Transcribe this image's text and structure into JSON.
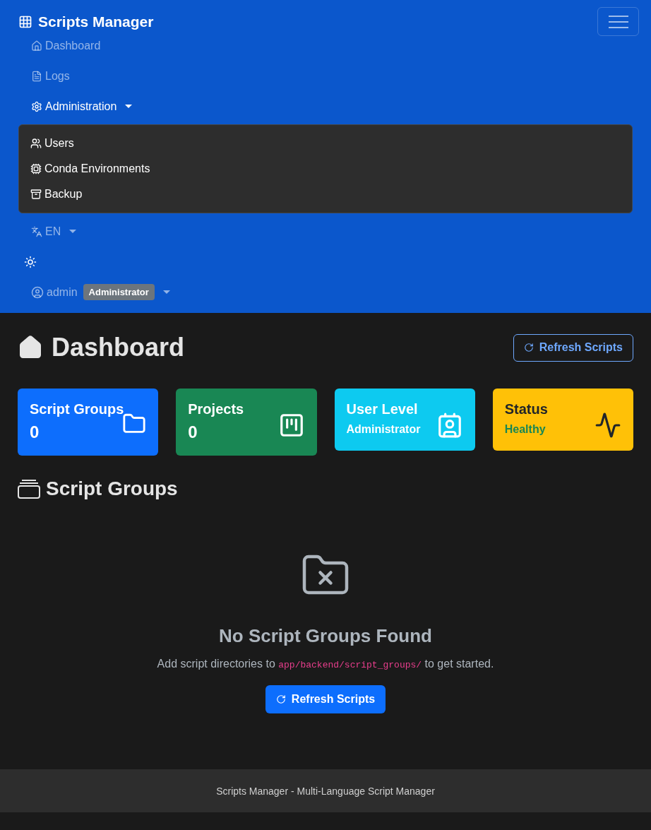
{
  "navbar": {
    "brand": "Scripts Manager",
    "items": [
      {
        "kind": "link",
        "label": "Dashboard",
        "active": false
      },
      {
        "kind": "link",
        "label": "Logs",
        "active": false
      },
      {
        "kind": "dropdown",
        "label": "Administration",
        "active": true,
        "expanded": true,
        "children": [
          {
            "label": "Users"
          },
          {
            "label": "Conda Environments"
          },
          {
            "label": "Backup"
          }
        ]
      },
      {
        "kind": "dropdown",
        "label": "EN",
        "active": false
      },
      {
        "kind": "theme"
      },
      {
        "kind": "user",
        "label": "admin",
        "badge": "Administrator",
        "active": false
      }
    ]
  },
  "page": {
    "title": "Dashboard",
    "refresh_button": "Refresh Scripts"
  },
  "cards": [
    {
      "kind": "count",
      "title": "Script Groups",
      "value": "0",
      "color": "#0d6efd"
    },
    {
      "kind": "count",
      "title": "Projects",
      "value": "0",
      "color": "#198754"
    },
    {
      "kind": "label",
      "title": "User Level",
      "value": "Administrator",
      "color": "#0dcaf0"
    },
    {
      "kind": "status",
      "title": "Status",
      "value": "Healthy",
      "color": "#ffc107"
    }
  ],
  "section": {
    "title": "Script Groups"
  },
  "empty_state": {
    "title": "No Script Groups Found",
    "text_before": "Add script directories to",
    "code": "app/backend/script_groups/",
    "text_after": "to get started.",
    "button": "Refresh Scripts"
  },
  "footer": "Scripts Manager - Multi-Language Script Manager"
}
